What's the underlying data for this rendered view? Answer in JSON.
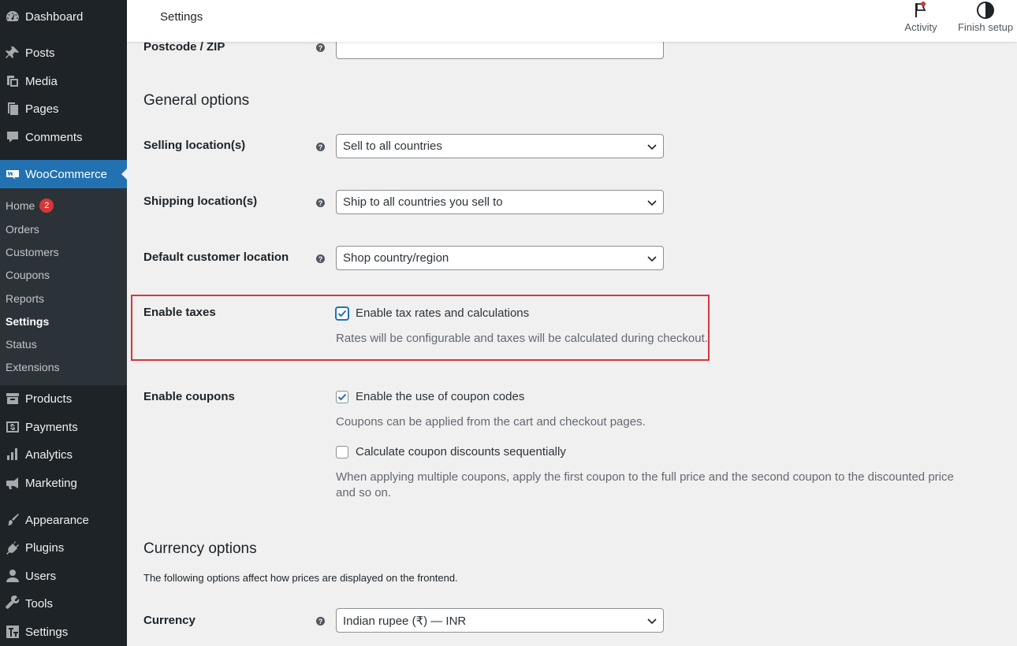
{
  "sidebar": {
    "items": [
      {
        "label": "Dashboard",
        "icon": "dashboard-icon"
      },
      {
        "label": "Posts",
        "icon": "pin-icon"
      },
      {
        "label": "Media",
        "icon": "media-icon"
      },
      {
        "label": "Pages",
        "icon": "pages-icon"
      },
      {
        "label": "Comments",
        "icon": "comment-icon"
      },
      {
        "label": "WooCommerce",
        "icon": "woocommerce-icon"
      },
      {
        "label": "Products",
        "icon": "archive-icon"
      },
      {
        "label": "Payments",
        "icon": "payments-icon"
      },
      {
        "label": "Analytics",
        "icon": "bar-chart-icon"
      },
      {
        "label": "Marketing",
        "icon": "megaphone-icon"
      },
      {
        "label": "Appearance",
        "icon": "brush-icon"
      },
      {
        "label": "Plugins",
        "icon": "plugin-icon"
      },
      {
        "label": "Users",
        "icon": "user-icon"
      },
      {
        "label": "Tools",
        "icon": "wrench-icon"
      },
      {
        "label": "Settings",
        "icon": "settings-icon"
      }
    ],
    "submenu": [
      {
        "label": "Home",
        "badge": "2"
      },
      {
        "label": "Orders"
      },
      {
        "label": "Customers"
      },
      {
        "label": "Coupons"
      },
      {
        "label": "Reports"
      },
      {
        "label": "Settings",
        "current": true
      },
      {
        "label": "Status"
      },
      {
        "label": "Extensions"
      }
    ]
  },
  "topbar": {
    "title": "Settings",
    "activity_label": "Activity",
    "finish_setup_label": "Finish setup"
  },
  "form": {
    "postcode_label": "Postcode / ZIP",
    "postcode_value": "",
    "general_title": "General options",
    "selling_label": "Selling location(s)",
    "selling_value": "Sell to all countries",
    "shipping_label": "Shipping location(s)",
    "shipping_value": "Ship to all countries you sell to",
    "default_customer_label": "Default customer location",
    "default_customer_value": "Shop country/region",
    "taxes_label": "Enable taxes",
    "taxes_checkbox_label": "Enable tax rates and calculations",
    "taxes_checked": true,
    "taxes_desc": "Rates will be configurable and taxes will be calculated during checkout.",
    "coupons_label": "Enable coupons",
    "coupons_checkbox_label": "Enable the use of coupon codes",
    "coupons_checked": true,
    "coupons_desc": "Coupons can be applied from the cart and checkout pages.",
    "sequential_checkbox_label": "Calculate coupon discounts sequentially",
    "sequential_checked": false,
    "sequential_desc": "When applying multiple coupons, apply the first coupon to the full price and the second coupon to the discounted price and so on.",
    "currency_title": "Currency options",
    "currency_intro": "The following options affect how prices are displayed on the frontend.",
    "currency_label": "Currency",
    "currency_value": "Indian rupee (₹) — INR"
  },
  "colors": {
    "sidebar_bg": "#1d2327",
    "accent": "#2271b1",
    "highlight_border": "#d63638",
    "badge": "#d63638"
  }
}
